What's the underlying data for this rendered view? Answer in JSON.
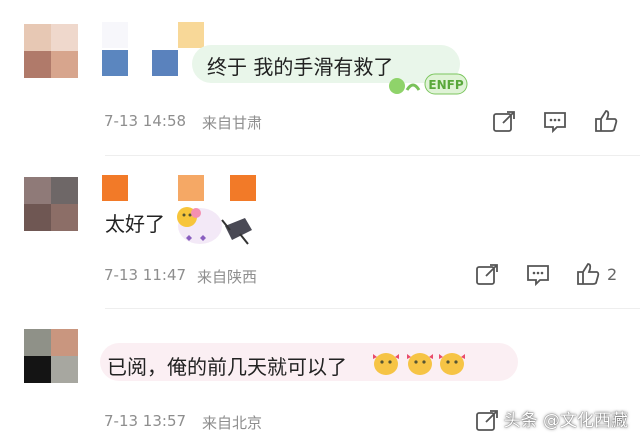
{
  "comments": [
    {
      "text": "终于 我的手滑有救了",
      "badge": "ENFP",
      "date": "7-13 14:58",
      "location": "来自甘肃",
      "likes": ""
    },
    {
      "text": "太好了",
      "date": "7-13 11:47",
      "location": "来自陕西",
      "likes": "2"
    },
    {
      "text": "已阅，俺的前几天就可以了",
      "date": "7-13 13:57",
      "location": "来自北京",
      "likes": ""
    }
  ],
  "watermark": "头条 @文化西藏",
  "icons": [
    "share-icon",
    "comment-icon",
    "thumbs-up-icon"
  ],
  "colors": {
    "meta": "#8e8e8e",
    "bubble_green": "#e9f6ea",
    "bubble_pink": "#fbeff3"
  }
}
